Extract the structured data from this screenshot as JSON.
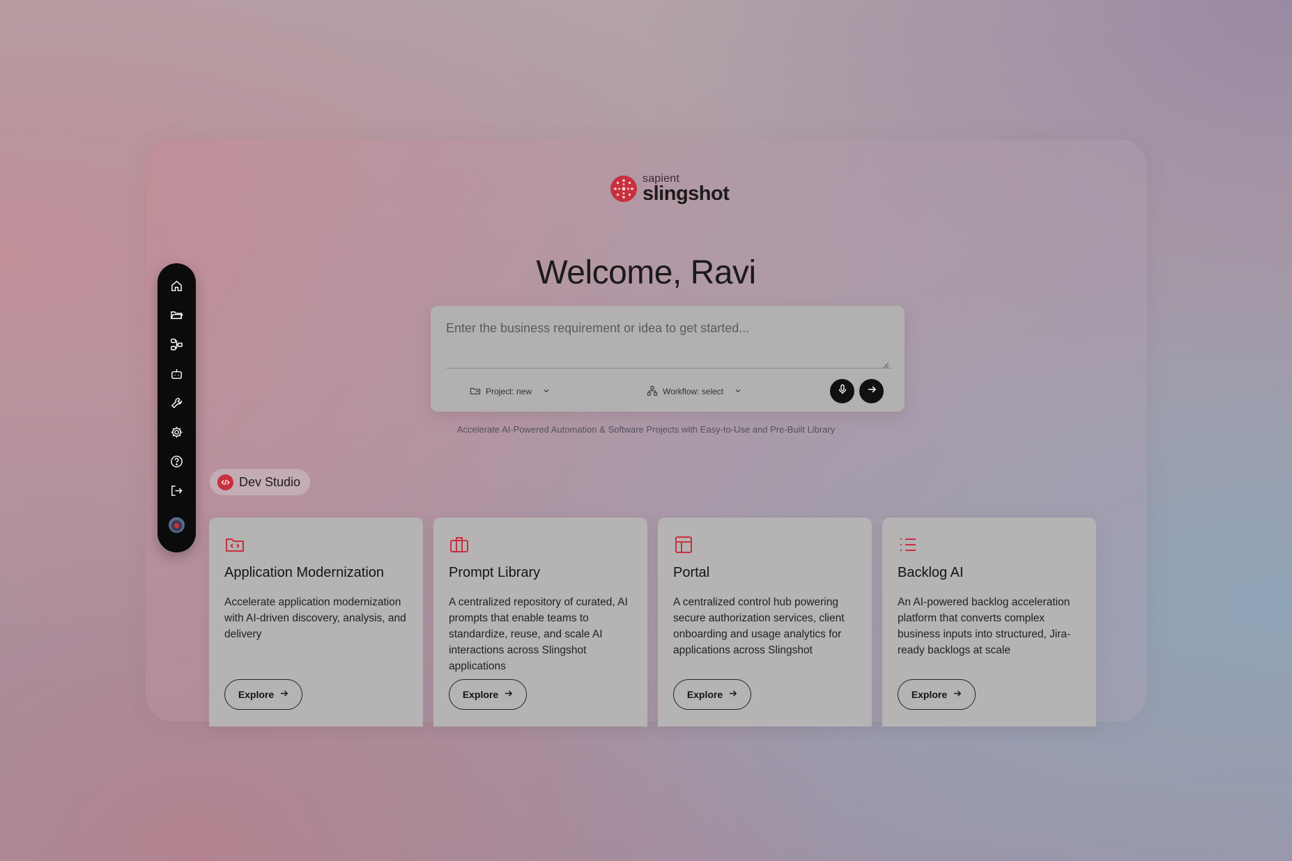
{
  "brand": {
    "sub": "sapient",
    "name": "slingshot",
    "accent": "#c9303f"
  },
  "welcome": "Welcome, Ravi",
  "prompt": {
    "placeholder": "Enter the business requirement or idea to get started...",
    "project_label": "Project: new",
    "workflow_label": "Workflow: select"
  },
  "tagline": "Accelerate AI-Powered Automation & Software Projects with Easy-to-Use and Pre-Built Library",
  "sidebar": {
    "items": [
      "home-icon",
      "folder-icon",
      "workflow-icon",
      "bot-icon",
      "wrench-icon",
      "gear-icon",
      "help-icon",
      "logout-icon"
    ]
  },
  "section": {
    "label": "Dev Studio"
  },
  "cards": [
    {
      "icon": "folder-code-icon",
      "title": "Application Modernization",
      "description": "Accelerate application modernization with AI-driven discovery, analysis, and delivery",
      "button": "Explore"
    },
    {
      "icon": "briefcase-icon",
      "title": "Prompt Library",
      "description": "A centralized repository of curated, AI prompts that enable teams to standardize, reuse, and scale AI interactions across Slingshot applications",
      "button": "Explore"
    },
    {
      "icon": "layout-icon",
      "title": "Portal",
      "description": "A centralized control hub powering secure authorization services, client onboarding and usage analytics for applications across Slingshot",
      "button": "Explore"
    },
    {
      "icon": "list-icon",
      "title": "Backlog AI",
      "description": "An AI-powered backlog acceleration platform that converts complex business inputs into structured, Jira-ready backlogs at scale",
      "button": "Explore"
    }
  ]
}
